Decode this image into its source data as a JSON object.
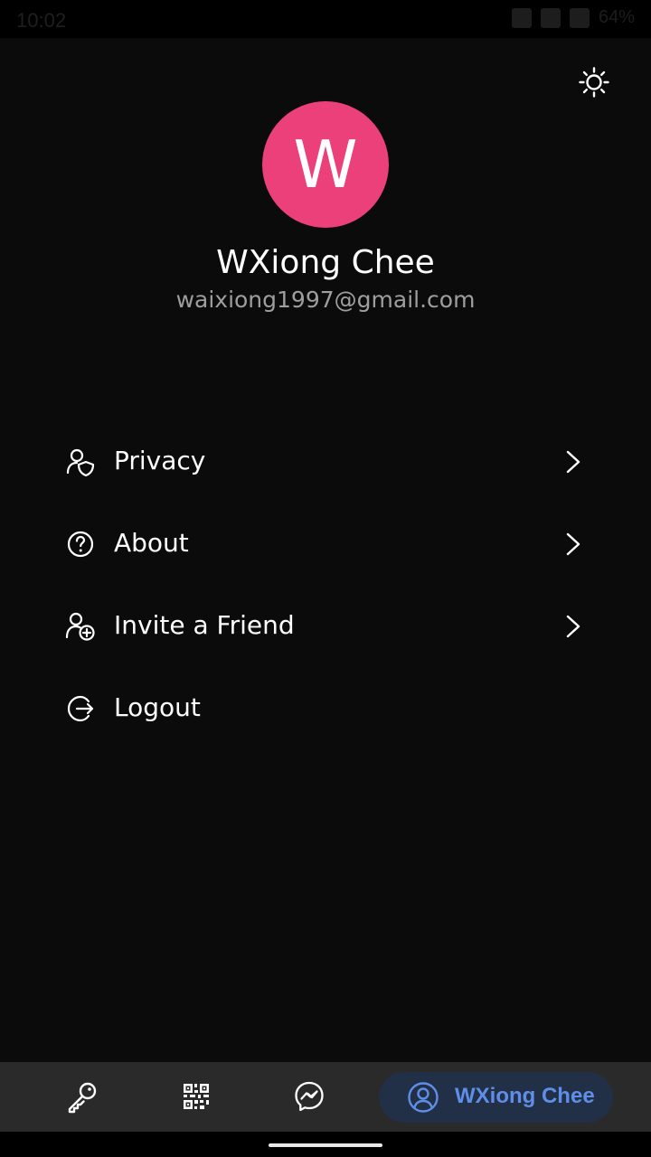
{
  "status_bar": {
    "time": "10:02",
    "battery": "64%"
  },
  "icons": {
    "theme_toggle": "sun-icon",
    "privacy": "user-shield-icon",
    "about": "help-circle-icon",
    "invite": "user-add-icon",
    "logout": "logout-icon",
    "chevron": "chevron-right-icon",
    "nav_key": "key-icon",
    "nav_qr": "qr-code-icon",
    "nav_messenger": "messenger-icon",
    "nav_profile": "user-circle-icon"
  },
  "colors": {
    "avatar_bg": "#ec407a",
    "accent": "#5f8ee8",
    "active_pill": "#223047",
    "background": "#0b0b0b",
    "nav_bar": "#2a2a2a"
  },
  "profile": {
    "initial": "W",
    "name": "WXiong Chee",
    "email": "waixiong1997@gmail.com"
  },
  "menu": {
    "items": [
      {
        "label": "Privacy",
        "has_chevron": true
      },
      {
        "label": "About",
        "has_chevron": true
      },
      {
        "label": "Invite a Friend",
        "has_chevron": true
      },
      {
        "label": "Logout",
        "has_chevron": false
      }
    ]
  },
  "bottom_nav": {
    "active_label": "WXiong Chee"
  }
}
